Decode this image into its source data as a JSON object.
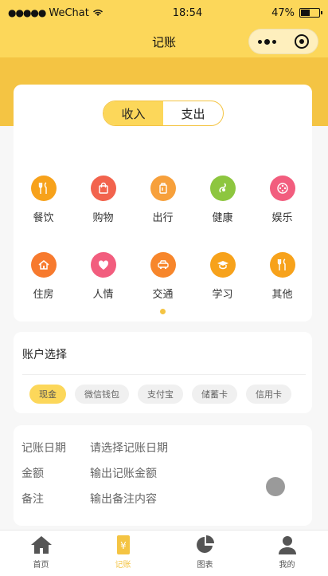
{
  "status_bar": {
    "carrier": "WeChat",
    "time": "18:54",
    "battery": "47%"
  },
  "nav": {
    "title": "记账"
  },
  "toggle": {
    "income": "收入",
    "expense": "支出"
  },
  "categories": [
    {
      "label": "餐饮",
      "icon": "utensils-icon",
      "color": "#f7a21b"
    },
    {
      "label": "购物",
      "icon": "shopping-bag-icon",
      "color": "#f2634d"
    },
    {
      "label": "出行",
      "icon": "luggage-icon",
      "color": "#f7a03b"
    },
    {
      "label": "健康",
      "icon": "health-icon",
      "color": "#8dc63f"
    },
    {
      "label": "娱乐",
      "icon": "film-reel-icon",
      "color": "#f25d7e"
    },
    {
      "label": "住房",
      "icon": "house-icon",
      "color": "#f77a2e"
    },
    {
      "label": "人情",
      "icon": "heart-icon",
      "color": "#f25d7e"
    },
    {
      "label": "交通",
      "icon": "car-icon",
      "color": "#f7862b"
    },
    {
      "label": "学习",
      "icon": "graduation-cap-icon",
      "color": "#f7a21b"
    },
    {
      "label": "其他",
      "icon": "utensils-icon",
      "color": "#f7a21b"
    }
  ],
  "account": {
    "title": "账户选择",
    "options": [
      "现金",
      "微信钱包",
      "支付宝",
      "储蓄卡",
      "信用卡"
    ]
  },
  "form": {
    "date_label": "记账日期",
    "date_placeholder": "请选择记账日期",
    "amount_label": "金额",
    "amount_placeholder": "输出记账金额",
    "note_label": "备注",
    "note_placeholder": "输出备注内容"
  },
  "tabs": [
    {
      "label": "首页",
      "icon": "home-icon"
    },
    {
      "label": "记账",
      "icon": "bookkeeping-icon"
    },
    {
      "label": "图表",
      "icon": "pie-chart-icon"
    },
    {
      "label": "我的",
      "icon": "user-icon"
    }
  ],
  "colors": {
    "accent": "#fcd75a",
    "accent_dark": "#f4c443"
  }
}
